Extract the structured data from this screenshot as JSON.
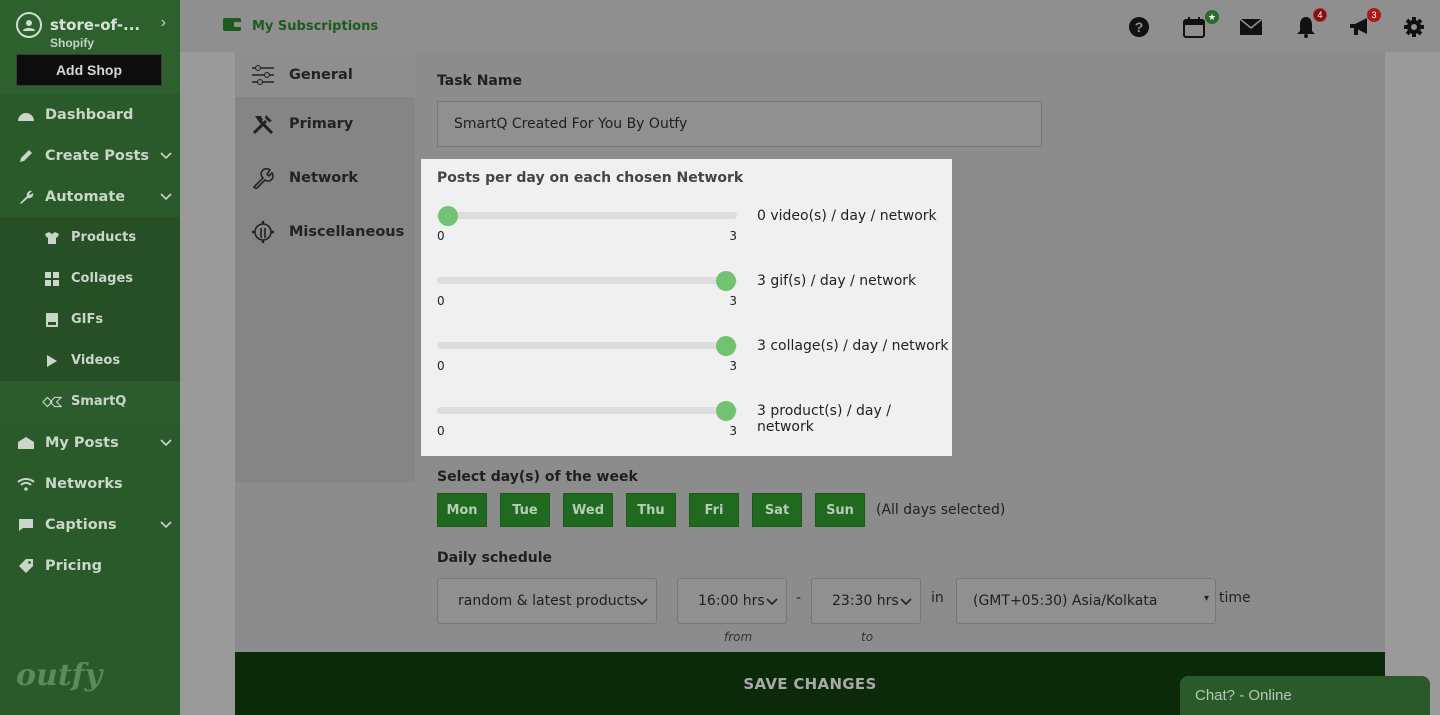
{
  "sidebar": {
    "shop_name": "store-of-...",
    "shop_platform": "Shopify",
    "add_shop": "Add Shop",
    "items": [
      {
        "label": "Dashboard"
      },
      {
        "label": "Create Posts"
      },
      {
        "label": "Automate"
      },
      {
        "label": "My Posts"
      },
      {
        "label": "Networks"
      },
      {
        "label": "Captions"
      },
      {
        "label": "Pricing"
      }
    ],
    "automate_sub": [
      {
        "label": "Products"
      },
      {
        "label": "Collages"
      },
      {
        "label": "GIFs"
      },
      {
        "label": "Videos"
      },
      {
        "label": "SmartQ"
      }
    ],
    "logo": "outfy"
  },
  "topbar": {
    "subscriptions": "My Subscriptions",
    "notification_badge": "4",
    "announcement_badge": "3"
  },
  "tabs": [
    {
      "label": "General"
    },
    {
      "label": "Primary"
    },
    {
      "label": "Network"
    },
    {
      "label": "Miscellaneous"
    }
  ],
  "form": {
    "task_name_label": "Task Name",
    "task_name_value": "SmartQ Created For You By Outfy",
    "posts_per_day_label": "Posts per day on each chosen Network",
    "sliders": [
      {
        "value": 0,
        "min": "0",
        "max": "3",
        "label": "0 video(s) / day / network"
      },
      {
        "value": 3,
        "min": "0",
        "max": "3",
        "label": "3 gif(s) / day / network"
      },
      {
        "value": 3,
        "min": "0",
        "max": "3",
        "label": "3 collage(s) / day / network"
      },
      {
        "value": 3,
        "min": "0",
        "max": "3",
        "label": "3 product(s) / day / network"
      }
    ],
    "days_label": "Select day(s) of the week",
    "days": [
      "Mon",
      "Tue",
      "Wed",
      "Thu",
      "Fri",
      "Sat",
      "Sun"
    ],
    "days_note": "(All days selected)",
    "schedule_label": "Daily schedule",
    "source_value": "random & latest products",
    "from_value": "16:00 hrs",
    "dash": "-",
    "to_value": "23:30 hrs",
    "in_text": "in",
    "timezone_value": "(GMT+05:30) Asia/Kolkata",
    "time_text": "time",
    "from_label": "from",
    "to_label": "to"
  },
  "save_label": "SAVE CHANGES",
  "chat_label": "Chat? - Online",
  "colors": {
    "accent": "#72c272",
    "sidebar": "#2a5a2a",
    "day_button": "#1f6a1f"
  }
}
